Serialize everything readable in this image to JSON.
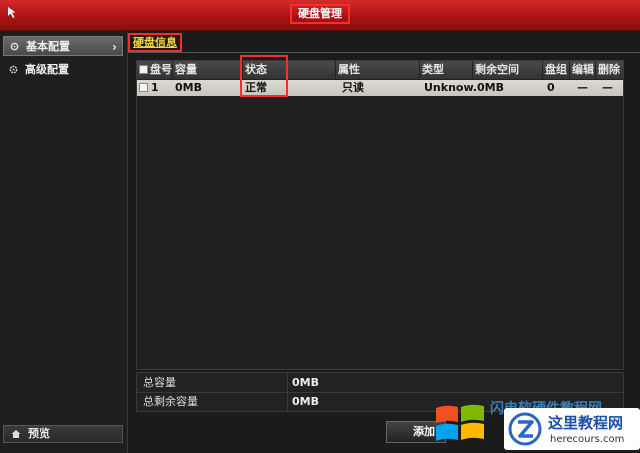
{
  "window": {
    "title": "硬盘管理"
  },
  "sidebar": {
    "items": [
      {
        "label": "基本配置",
        "icon": "gear-icon",
        "active": true
      },
      {
        "label": "高级配置",
        "icon": "gear-icon",
        "active": false
      }
    ],
    "preview_label": "预览"
  },
  "tabs": [
    {
      "label": "硬盘信息"
    }
  ],
  "table": {
    "headers": [
      "盘号",
      "容量",
      "状态",
      "属性",
      "类型",
      "剩余空间",
      "盘组",
      "编辑",
      "删除"
    ],
    "rows": [
      {
        "no": "1",
        "capacity": "0MB",
        "status": "正常",
        "attr": "只读",
        "type": "Unknow...",
        "free": "0MB",
        "group": "0",
        "edit": "—",
        "delete": "—"
      }
    ]
  },
  "summary": {
    "total_label": "总容量",
    "total_value": "0MB",
    "free_label": "总剩余容量",
    "free_value": "0MB"
  },
  "buttons": {
    "add_label": "添加"
  },
  "watermark": {
    "title": "这里教程网",
    "url": "herecours.com",
    "overlay": "闪电软硬件教程网"
  }
}
